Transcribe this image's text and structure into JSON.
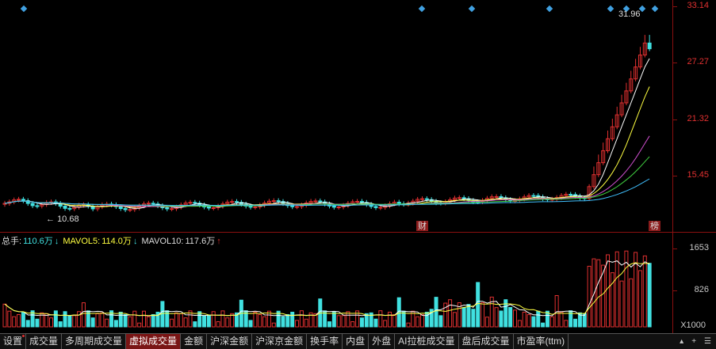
{
  "price_axis": {
    "labels": [
      "33.14",
      "27.27",
      "21.32",
      "15.45"
    ]
  },
  "volume_axis": {
    "labels": [
      "1653",
      "826"
    ],
    "unit": "X1000"
  },
  "annotations": {
    "high_price": "31.96",
    "low_price": "10.68",
    "event_cai": "财",
    "event_bang": "榜"
  },
  "volume_header": {
    "total_label": "总手:",
    "total_value": "110.6万",
    "total_arrow": "↓",
    "mavol5_label": "MAVOL5:",
    "mavol5_value": "114.0万",
    "mavol5_arrow": "↓",
    "mavol10_label": "MAVOL10:",
    "mavol10_value": "117.6万",
    "mavol10_arrow": "↑"
  },
  "tabs": [
    "设置",
    "成交量",
    "多周期成交量",
    "虚拟成交量",
    "金额",
    "沪深金额",
    "沪深京金额",
    "换手率",
    "内盘",
    "外盘",
    "AI拉桩成交量",
    "盘后成交量",
    "市盈率(ttm)"
  ],
  "active_tab": "虚拟成交量",
  "tab_controls": {
    "collapse_icon": "collapse-icon",
    "plus_icon": "plus-icon",
    "menu_icon": "menu-icon"
  },
  "colors": {
    "up": "#e03030",
    "down": "#40e0e0",
    "ma1": "#ffffff",
    "ma2": "#ffff40",
    "ma3": "#d050d0",
    "ma4": "#40d040",
    "ma5": "#40c0ff",
    "accent": "#7a1515"
  }
}
